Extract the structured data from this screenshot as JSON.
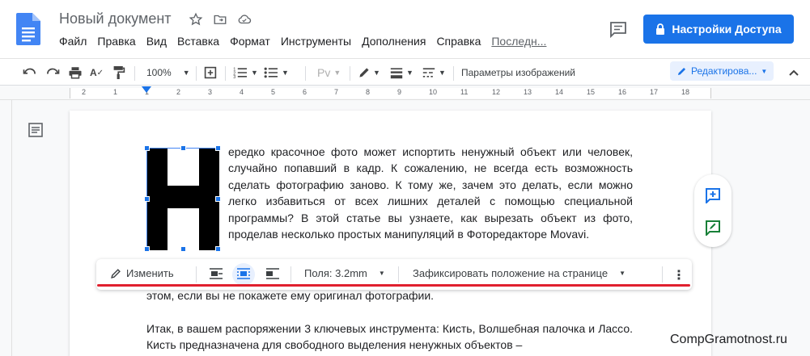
{
  "header": {
    "doc_title": "Новый документ",
    "menu": [
      "Файл",
      "Правка",
      "Вид",
      "Вставка",
      "Формат",
      "Инструменты",
      "Дополнения",
      "Справка"
    ],
    "last_edit": "Последн...",
    "share_label": "Настройки Доступа"
  },
  "toolbar": {
    "zoom": "100%",
    "image_options": "Параметры изображений",
    "mode": "Редактирова..."
  },
  "ruler": {
    "numbers": [
      "2",
      "1",
      "1",
      "2",
      "3",
      "4",
      "5",
      "6",
      "7",
      "8",
      "9",
      "10",
      "11",
      "12",
      "13",
      "14",
      "15",
      "16",
      "17",
      "18"
    ]
  },
  "document": {
    "big_letter": "Н",
    "paragraph1": "ередко красочное фото может испортить ненужный объект или человек, случайно попавший в кадр. К сожалению, не всегда есть возможность сделать фотографию заново. К тому же, зачем это делать, если можно легко избавиться от всех лишних деталей с помощью специальной программы? В этой статье вы узнаете, как вырезать объект из фото, проделав несколько простых манипуляций в Фоторедакторе Movavi.",
    "line_under_toolbar": "этом, если вы не покажете ему оригинал фотографии.",
    "paragraph2": "Итак, в вашем распоряжении 3 ключевых инструмента: Кисть, Волшебная палочка и Лассо. Кисть предназначена для свободного выделения ненужных объектов –"
  },
  "image_toolbar": {
    "edit_label": "Изменить",
    "margins_label": "Поля: 3.2mm",
    "fix_position_label": "Зафиксировать положение на странице"
  },
  "watermark": "CompGramotnost.ru",
  "colors": {
    "accent": "#1a73e8",
    "underline": "#e0202e",
    "add_comment": "#1a73e8",
    "suggest_edit": "#188038"
  }
}
